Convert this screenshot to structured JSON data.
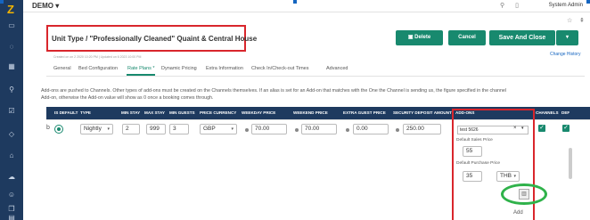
{
  "sidebar": {
    "logo": "Z",
    "icons": [
      "inbox-icon",
      "chat-icon",
      "grid-icon",
      "pin-icon",
      "checklist-icon",
      "tag-icon",
      "home-icon",
      "cloud-icon",
      "person-icon",
      "copy-icon",
      "document-icon"
    ]
  },
  "topbar": {
    "brand": "DEMO",
    "brand_caret": "▾",
    "search_icon": "search-icon",
    "mouse_icon": "mouse-icon",
    "admin_label": "System Admin"
  },
  "header": {
    "title": "Unit Type / \"Professionally Cleaned\" Quaint & Central House",
    "subtitle": "Created on on 2 2020 10:20 PM | Updated on 6 2023 10:00 PM",
    "star_icon": "☆",
    "pin_icon": "⇞",
    "change_history": "Change History"
  },
  "actions": {
    "delete_label": "Delete",
    "cancel_label": "Cancel",
    "save_close_label": "Save And Close",
    "more_label": "▾"
  },
  "tabs": [
    "General",
    "Bed Configuration",
    "Rate Plans *",
    "Dynamic Pricing",
    "Extra Information",
    "Check In/Check-out Times",
    "Advanced"
  ],
  "info_text": {
    "line1": "Add-ons are pushed to Channels. Other types of add-ons must be created on the Channels themselves. If an alias is set for an Add-on that matches with the One the Channel is sending us, the figure specified in the channel",
    "line2": "Add-on, otherwise the Add-on value will show as 0 once a booking comes through."
  },
  "table": {
    "headers": {
      "is_default": "IS DEFAULT",
      "type": "TYPE",
      "min_stay": "MIN STAY",
      "max_stay": "MAX STAY",
      "min_guests": "MIN GUESTS",
      "price_currency": "PRICE CURRENCY",
      "weekday_price": "WEEKDAY PRICE",
      "weekend_price": "WEEKEND PRICE",
      "extra_guest_price": "EXTRA GUEST PRICE",
      "security_deposit": "SECURITY DEPOSIT AMOUNT",
      "add_ons": "ADD-ONS",
      "channels": "CHANNELS",
      "extra_col": "DEF"
    },
    "row": {
      "col_b": "b",
      "type": "Nightly",
      "min_stay": "2",
      "max_stay": "999",
      "min_guests": "3",
      "currency": "GBP",
      "weekday_price": "70.00",
      "weekend_price": "70.00",
      "extra_guest_price": "0.00",
      "security_deposit": "250.00"
    }
  },
  "addon": {
    "selected": "test 5626",
    "clear_icon": "×",
    "caret": "▾",
    "sales_label": "Default Sales Price",
    "sales_value": "55",
    "purchase_label": "Default Purchase Price",
    "purchase_value": "35",
    "currency": "THB",
    "add_label": "Add"
  },
  "colors": {
    "sidebar": "#1e3a5f",
    "accent": "#18896e",
    "highlight_red": "#d9262c",
    "highlight_green": "#2fb24a",
    "link": "#1565c0"
  }
}
